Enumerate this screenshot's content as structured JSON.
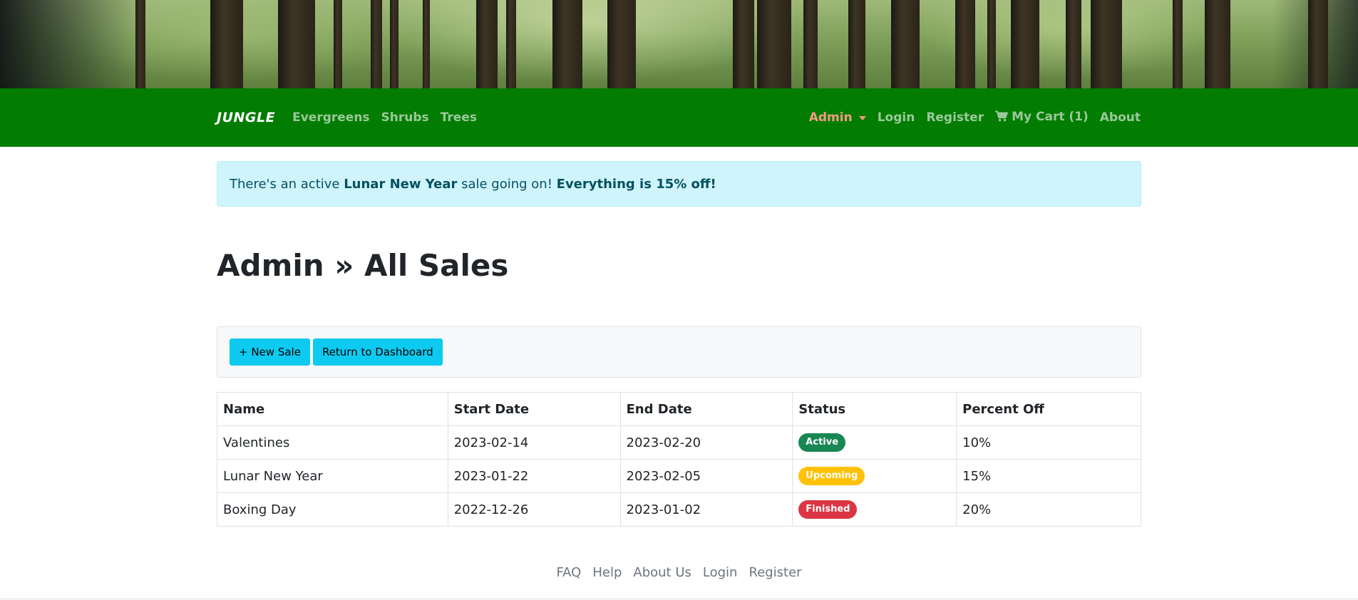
{
  "colors": {
    "navbar_bg": "#027d01",
    "nav_link": "#9bc89a",
    "admin_link": "#f39a84",
    "alert_bg": "#cff4fc",
    "alert_text": "#055160",
    "button_bg": "#0dcaf0",
    "badge_active": "#198754",
    "badge_upcoming": "#ffc107",
    "badge_finished": "#dc3545"
  },
  "navbar": {
    "brand": "JUNGLE",
    "left_links": [
      {
        "label": "Evergreens"
      },
      {
        "label": "Shrubs"
      },
      {
        "label": "Trees"
      }
    ],
    "admin_label": "Admin",
    "login_label": "Login",
    "register_label": "Register",
    "cart_label": "My Cart (1)",
    "cart_icon": "shopping-cart-icon",
    "about_label": "About"
  },
  "alert": {
    "prefix": "There's an active ",
    "sale_name": "Lunar New Year",
    "middle": " sale going on! ",
    "discount_text": "Everything is 15% off!"
  },
  "page": {
    "title": "Admin » All Sales"
  },
  "toolbar": {
    "new_sale_label": "+ New Sale",
    "dashboard_label": "Return to Dashboard"
  },
  "table": {
    "headers": [
      "Name",
      "Start Date",
      "End Date",
      "Status",
      "Percent Off"
    ],
    "rows": [
      {
        "name": "Valentines",
        "start": "2023-02-14",
        "end": "2023-02-20",
        "status": "Active",
        "status_color": "#198754",
        "percent": "10%"
      },
      {
        "name": "Lunar New Year",
        "start": "2023-01-22",
        "end": "2023-02-05",
        "status": "Upcoming",
        "status_color": "#ffc107",
        "percent": "15%"
      },
      {
        "name": "Boxing Day",
        "start": "2022-12-26",
        "end": "2023-01-02",
        "status": "Finished",
        "status_color": "#dc3545",
        "percent": "20%"
      }
    ]
  },
  "footer": {
    "links": [
      {
        "label": "FAQ"
      },
      {
        "label": "Help"
      },
      {
        "label": "About Us"
      },
      {
        "label": "Login"
      },
      {
        "label": "Register"
      }
    ]
  }
}
